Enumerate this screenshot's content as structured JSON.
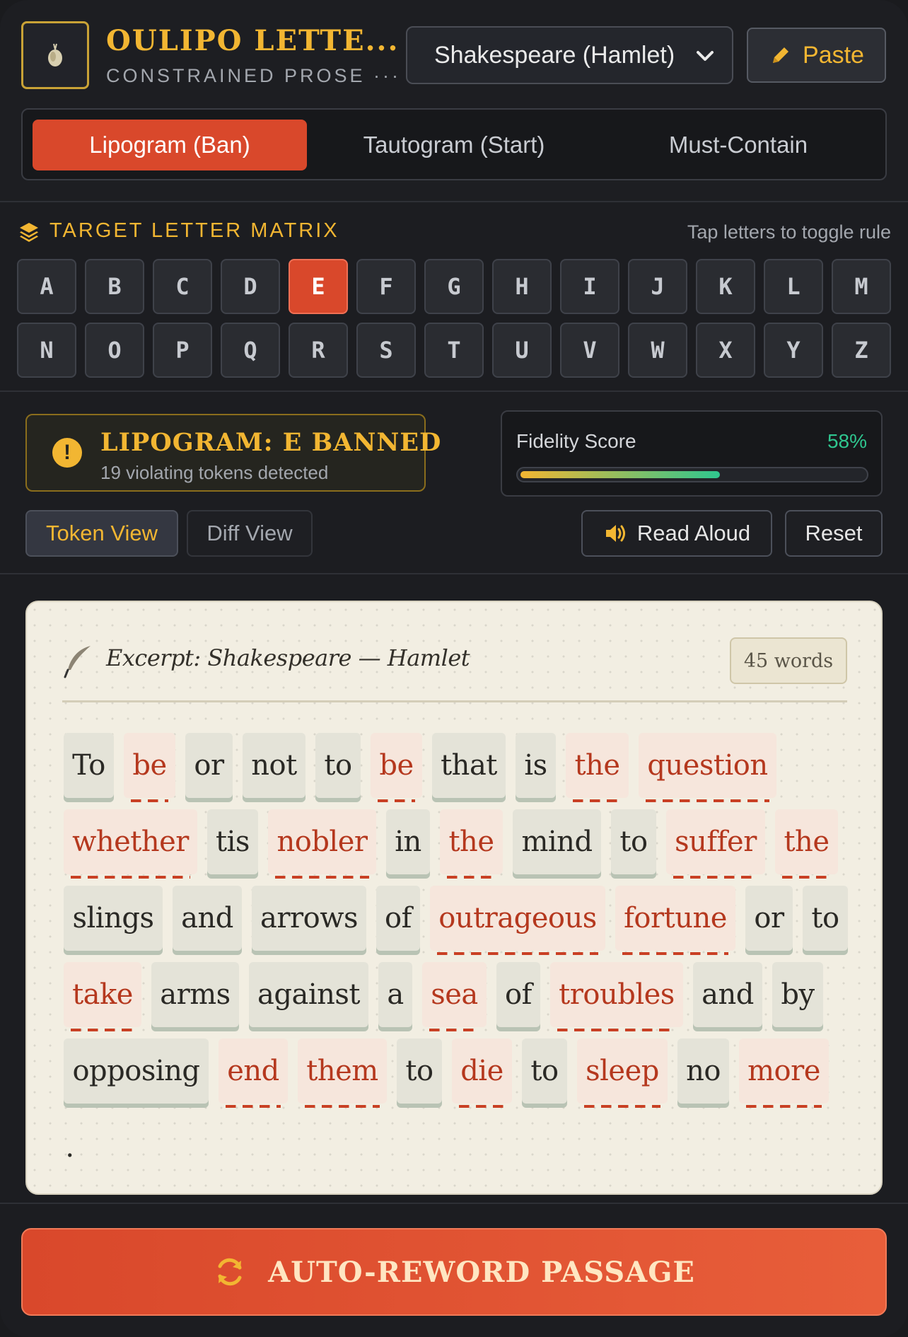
{
  "header": {
    "title": "OULIPO LETTE...",
    "subtitle": "CONSTRAINED PROSE ···",
    "source_select_value": "Shakespeare (Hamlet)",
    "paste_label": "Paste",
    "logo_icon": "quill-nib-icon"
  },
  "mode_tabs": [
    {
      "label": "Lipogram (Ban)",
      "active": true
    },
    {
      "label": "Tautogram (Start)",
      "active": false
    },
    {
      "label": "Must-Contain",
      "active": false
    }
  ],
  "matrix": {
    "title": "TARGET LETTER MATRIX",
    "hint": "Tap letters to toggle rule",
    "letters": [
      "A",
      "B",
      "C",
      "D",
      "E",
      "F",
      "G",
      "H",
      "I",
      "J",
      "K",
      "L",
      "M",
      "N",
      "O",
      "P",
      "Q",
      "R",
      "S",
      "T",
      "U",
      "V",
      "W",
      "X",
      "Y",
      "Z"
    ],
    "active_letter": "E"
  },
  "status": {
    "warning_title": "LIPOGRAM: E BANNED",
    "warning_sub": "19 violating tokens detected",
    "fidelity_label": "Fidelity Score",
    "fidelity_value": "58%",
    "fidelity_fraction": 0.58
  },
  "view_buttons": {
    "token_view": "Token View",
    "diff_view": "Diff View",
    "read_aloud": "Read Aloud",
    "reset": "Reset"
  },
  "passage": {
    "title": "Excerpt: Shakespeare — Hamlet",
    "word_count": "45 words",
    "tokens": [
      {
        "text": "To",
        "violation": false
      },
      {
        "text": "be",
        "violation": true
      },
      {
        "text": "or",
        "violation": false
      },
      {
        "text": "not",
        "violation": false
      },
      {
        "text": "to",
        "violation": false
      },
      {
        "text": "be",
        "violation": true
      },
      {
        "text": "that",
        "violation": false
      },
      {
        "text": "is",
        "violation": false
      },
      {
        "text": "the",
        "violation": true
      },
      {
        "text": "question",
        "violation": true
      },
      {
        "text": "whether",
        "violation": true
      },
      {
        "text": "tis",
        "violation": false
      },
      {
        "text": "nobler",
        "violation": true
      },
      {
        "text": "in",
        "violation": false
      },
      {
        "text": "the",
        "violation": true
      },
      {
        "text": "mind",
        "violation": false
      },
      {
        "text": "to",
        "violation": false
      },
      {
        "text": "suffer",
        "violation": true
      },
      {
        "text": "the",
        "violation": true
      },
      {
        "text": "slings",
        "violation": false
      },
      {
        "text": "and",
        "violation": false
      },
      {
        "text": "arrows",
        "violation": false
      },
      {
        "text": "of",
        "violation": false
      },
      {
        "text": "outrageous",
        "violation": true
      },
      {
        "text": "fortune",
        "violation": true
      },
      {
        "text": "or",
        "violation": false
      },
      {
        "text": "to",
        "violation": false
      },
      {
        "text": "take",
        "violation": true
      },
      {
        "text": "arms",
        "violation": false
      },
      {
        "text": "against",
        "violation": false
      },
      {
        "text": "a",
        "violation": false
      },
      {
        "text": "sea",
        "violation": true
      },
      {
        "text": "of",
        "violation": false
      },
      {
        "text": "troubles",
        "violation": true
      },
      {
        "text": "and",
        "violation": false
      },
      {
        "text": "by",
        "violation": false
      },
      {
        "text": "opposing",
        "violation": false
      },
      {
        "text": "end",
        "violation": true
      },
      {
        "text": "them",
        "violation": true
      },
      {
        "text": "to",
        "violation": false
      },
      {
        "text": "die",
        "violation": true
      },
      {
        "text": "to",
        "violation": false
      },
      {
        "text": "sleep",
        "violation": true
      },
      {
        "text": "no",
        "violation": false
      },
      {
        "text": "more",
        "violation": true
      },
      {
        "text": ".",
        "violation": false,
        "punct": true
      }
    ]
  },
  "footer": {
    "reword_label": "AUTO-REWORD PASSAGE"
  },
  "colors": {
    "accent": "#d9482b",
    "gold": "#f2b632",
    "success": "#2fc68f",
    "violation_text": "#b5381e",
    "paper": "#f2eee2"
  }
}
